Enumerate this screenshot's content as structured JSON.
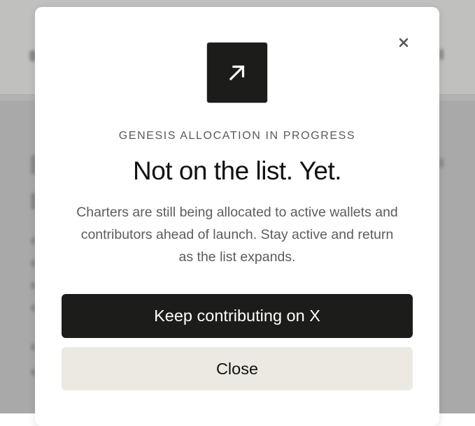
{
  "modal": {
    "eyebrow": "GENESIS ALLOCATION IN PROGRESS",
    "headline": "Not on the list. Yet.",
    "body": "Charters are still being allocated to active wallets and contributors ahead of launch. Stay active and return as the list expands.",
    "primary_button": "Keep contributing on X",
    "secondary_button": "Close",
    "icons": {
      "tile": "arrow-up-right-icon",
      "dismiss": "close-icon"
    }
  },
  "colors": {
    "tile_bg": "#1c1c1a",
    "primary_bg": "#1c1c1a",
    "secondary_bg": "#ece9e2",
    "overlay": "#a9a9a9"
  }
}
